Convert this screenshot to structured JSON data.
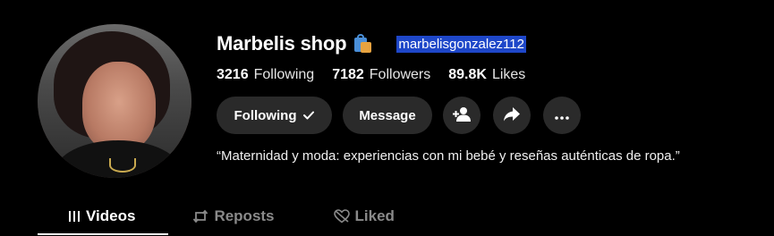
{
  "profile": {
    "name": "Marbelis shop",
    "name_icon": "shopping-bags-icon",
    "username": "marbelisgonzalez112",
    "bio": "“Maternidad y moda: experiencias con mi bebé y reseñas auténticas de ropa.”"
  },
  "stats": [
    {
      "value": "3216",
      "label": "Following"
    },
    {
      "value": "7182",
      "label": "Followers"
    },
    {
      "value": "89.8K",
      "label": "Likes"
    }
  ],
  "actions": {
    "following_label": "Following",
    "following_icon": "checkmark-icon",
    "message_label": "Message",
    "icons": [
      "add-friend-icon",
      "share-icon",
      "more-icon"
    ]
  },
  "tabs": [
    {
      "label": "Videos",
      "icon": "grid-icon",
      "active": true
    },
    {
      "label": "Reposts",
      "icon": "repost-icon",
      "active": false
    },
    {
      "label": "Liked",
      "icon": "heart-off-icon",
      "active": false
    }
  ],
  "colors": {
    "background": "#000000",
    "button": "#2a2a2a",
    "selection": "#1e47c9",
    "inactive_tab": "#8a8a8a"
  }
}
